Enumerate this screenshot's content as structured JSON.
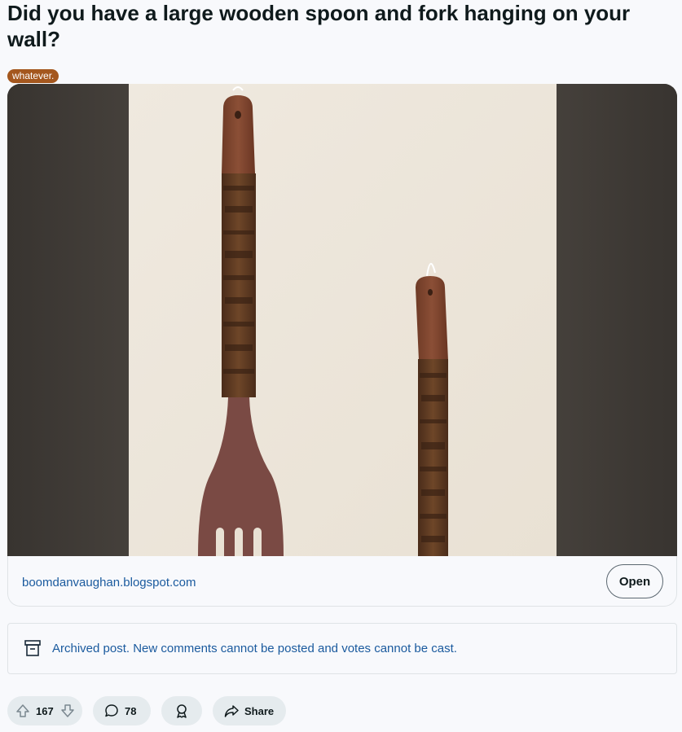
{
  "post": {
    "title": "Did you have a large wooden spoon and fork hanging on your wall?",
    "flair": "whatever.",
    "flair_color": "#a4571e"
  },
  "media": {
    "image_alt": "Carved wooden fork and spoon hanging on a wall",
    "link_domain": "boomdanvaughan.blogspot.com",
    "open_label": "Open"
  },
  "archived_notice": {
    "text": "Archived post. New comments cannot be posted and votes cannot be cast.",
    "icon": "archive-box-icon"
  },
  "actions": {
    "vote_count": "167",
    "comment_count": "78",
    "share_label": "Share",
    "icons": [
      "upvote-icon",
      "downvote-icon",
      "comment-icon",
      "award-icon",
      "share-icon"
    ]
  },
  "colors": {
    "background": "#f8f9fc",
    "link": "#1a5a9e",
    "pill": "#e5ebee"
  }
}
